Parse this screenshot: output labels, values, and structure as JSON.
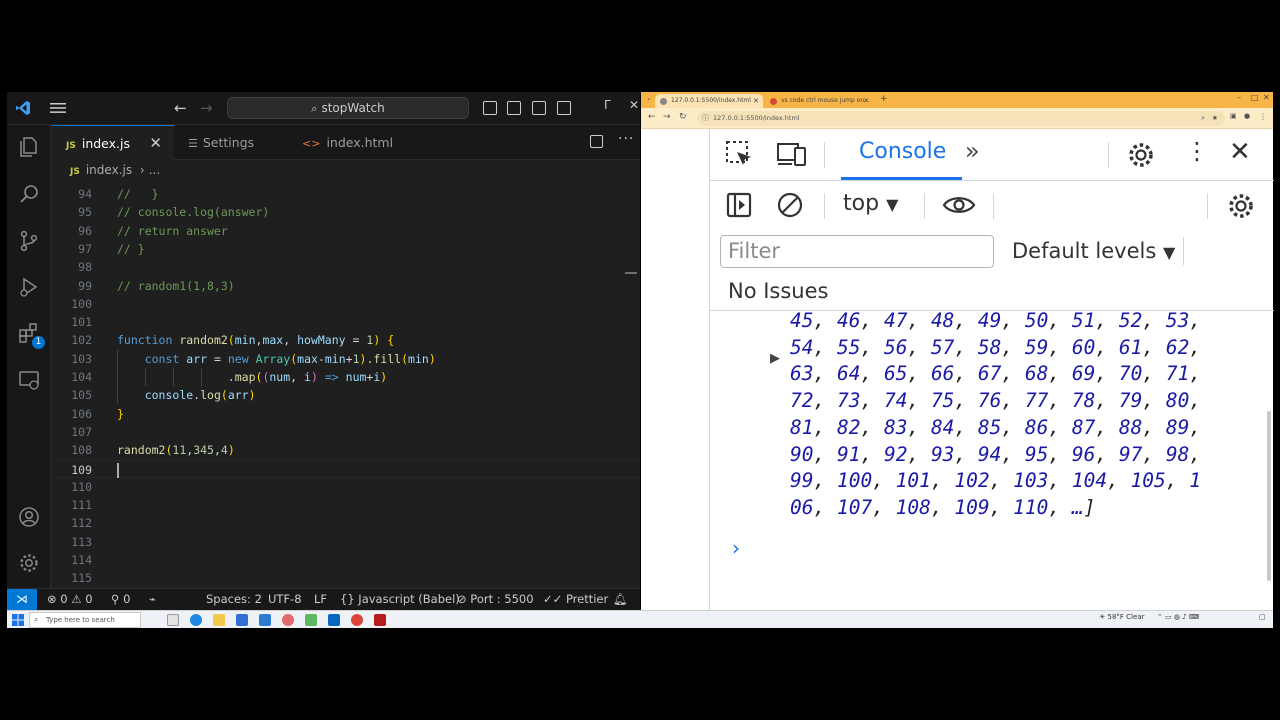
{
  "vscode": {
    "search_text": "stopWatch",
    "tabs": [
      {
        "label": "index.js",
        "type": "js",
        "active": true
      },
      {
        "label": "Settings",
        "type": "settings",
        "active": false
      },
      {
        "label": "index.html",
        "type": "html",
        "active": false
      }
    ],
    "breadcrumb": {
      "file": "index.js",
      "more": "..."
    },
    "lines": [
      {
        "num": "94",
        "text": "//   }"
      },
      {
        "num": "95",
        "text": "// console.log(answer)"
      },
      {
        "num": "96",
        "text": "// return answer"
      },
      {
        "num": "97",
        "text": "// }"
      },
      {
        "num": "98",
        "text": ""
      },
      {
        "num": "99",
        "text": "// random1(1,8,3)"
      },
      {
        "num": "100",
        "text": ""
      },
      {
        "num": "101",
        "text": ""
      },
      {
        "num": "102",
        "text": "function random2(min,max, howMany = 1) {"
      },
      {
        "num": "103",
        "text": "    const arr = new Array(max-min+1).fill(min)"
      },
      {
        "num": "104",
        "text": "                .map((num, i) => num+i)"
      },
      {
        "num": "105",
        "text": "    console.log(arr)"
      },
      {
        "num": "106",
        "text": "}"
      },
      {
        "num": "107",
        "text": ""
      },
      {
        "num": "108",
        "text": "random2(11,345,4)"
      },
      {
        "num": "109",
        "text": ""
      },
      {
        "num": "110",
        "text": ""
      },
      {
        "num": "111",
        "text": ""
      },
      {
        "num": "112",
        "text": ""
      },
      {
        "num": "113",
        "text": ""
      },
      {
        "num": "114",
        "text": ""
      },
      {
        "num": "115",
        "text": ""
      }
    ],
    "status": {
      "errors": "0",
      "warnings": "0",
      "ports": "0",
      "spaces": "Spaces: 2",
      "encoding": "UTF-8",
      "eol": "LF",
      "language": "Javascript (Babel)",
      "port": "Port : 5500",
      "formatter": "Prettier"
    },
    "activity_badge": "1"
  },
  "taskbar": {
    "search_placeholder": "Type here to search",
    "weather": "58°F  Clear"
  },
  "chrome": {
    "tab1_title": "127.0.0.1:5500/index.html",
    "tab2_title": "vs code ctrl mouse jump on...",
    "address": "127.0.0.1:5500/index.html"
  },
  "devtools": {
    "active_tab": "Console",
    "context": "top",
    "filter_placeholder": "Filter",
    "levels": "Default levels",
    "issues": "No Issues",
    "output_lines": [
      "45, 46, 47, 48, 49, 50, 51, 52, 53,",
      "54, 55, 56, 57, 58, 59, 60, 61, 62,",
      "63, 64, 65, 66, 67, 68, 69, 70, 71,",
      "72, 73, 74, 75, 76, 77, 78, 79, 80,",
      "81, 82, 83, 84, 85, 86, 87, 88, 89,",
      "90, 91, 92, 93, 94, 95, 96, 97, 98,",
      "99, 100, 101, 102, 103, 104, 105, 1",
      "06, 107, 108, 109, 110, …]"
    ],
    "prompt": "›"
  }
}
